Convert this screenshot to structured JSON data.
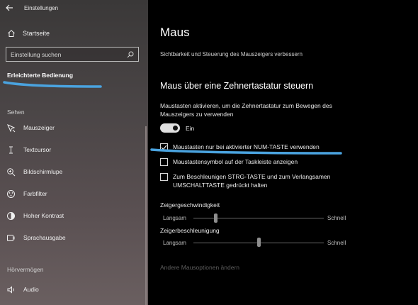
{
  "window": {
    "title": "Einstellungen"
  },
  "sidebar": {
    "home_label": "Startseite",
    "search_placeholder": "Einstellung suchen",
    "category": "Erleichterte Bedienung",
    "group_sehen": "Sehen",
    "group_hoeren": "Hörvermögen",
    "items": [
      {
        "label": "Mauszeiger",
        "icon": "mouse-pointer-icon"
      },
      {
        "label": "Textcursor",
        "icon": "text-cursor-icon"
      },
      {
        "label": "Bildschirmlupe",
        "icon": "magnifier-icon"
      },
      {
        "label": "Farbfilter",
        "icon": "color-filter-icon"
      },
      {
        "label": "Hoher Kontrast",
        "icon": "high-contrast-icon"
      },
      {
        "label": "Sprachausgabe",
        "icon": "narrator-icon"
      },
      {
        "label": "Audio",
        "icon": "speaker-icon"
      }
    ]
  },
  "main": {
    "title": "Maus",
    "subtitle": "Sichtbarkeit und Steuerung des Mauszeigers verbessern",
    "section_title": "Maus über eine Zehnertastatur steuern",
    "description": "Maustasten aktivieren, um die Zehnertastatur zum Bewegen des Mauszeigers zu verwenden",
    "toggle": {
      "label": "Ein",
      "on": true
    },
    "checkboxes": [
      {
        "label": "Maustasten nur bei aktivierter NUM-TASTE verwenden",
        "checked": true
      },
      {
        "label": "Maustastensymbol auf der Taskleiste anzeigen",
        "checked": false
      },
      {
        "label": "Zum Beschleunigen STRG-TASTE und zum Verlangsamen UMSCHALTTASTE gedrückt halten",
        "checked": false
      }
    ],
    "sliders": [
      {
        "title": "Zeigergeschwindigkeit",
        "min_label": "Langsam",
        "max_label": "Schnell",
        "level": 0.17
      },
      {
        "title": "Zeigerbeschleunigung",
        "min_label": "Langsam",
        "max_label": "Schnell",
        "level": 0.5
      }
    ],
    "more_link": "Andere Mausoptionen ändern"
  },
  "colors": {
    "highlight_underline": "#4aa3df",
    "accent_toggle": "#e0e0e0"
  }
}
